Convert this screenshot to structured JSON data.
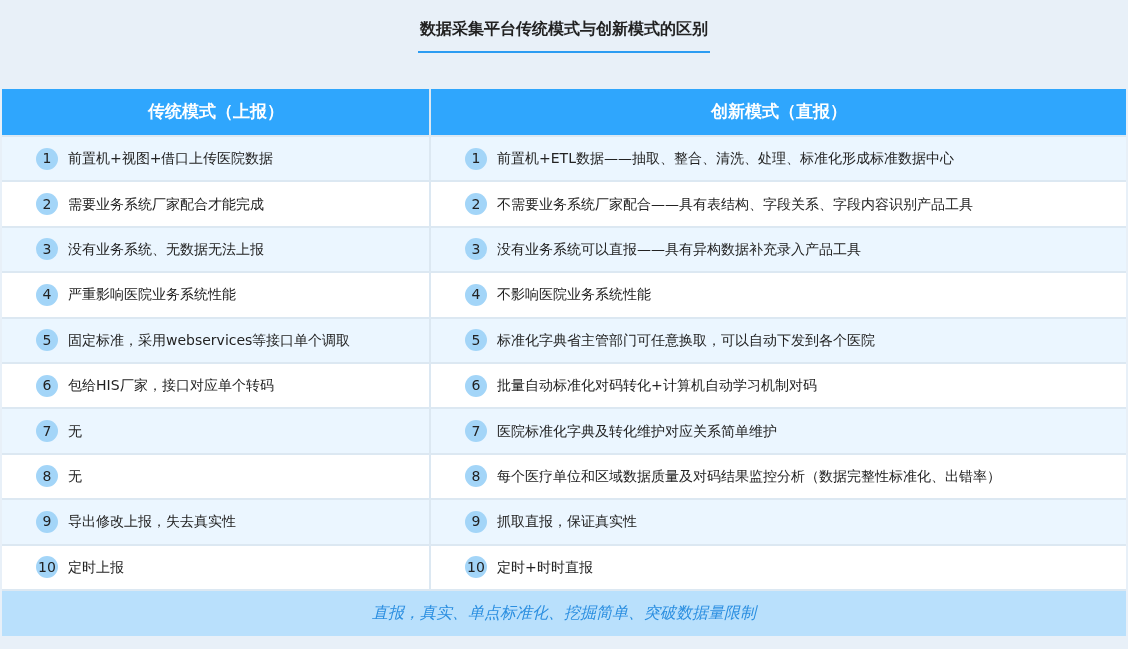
{
  "title": "数据采集平台传统模式与创新模式的区别",
  "table": {
    "columns": [
      "传统模式（上报）",
      "创新模式（直报）"
    ],
    "rows": [
      {
        "cells": [
          {
            "number": "1",
            "text": "前置机+视图+借口上传医院数据"
          },
          {
            "number": "1",
            "text": "前置机+ETL数据——抽取、整合、清洗、处理、标准化形成标准数据中心"
          }
        ]
      },
      {
        "cells": [
          {
            "number": "2",
            "text": "需要业务系统厂家配合才能完成"
          },
          {
            "number": "2",
            "text": "不需要业务系统厂家配合——具有表结构、字段关系、字段内容识别产品工具"
          }
        ]
      },
      {
        "cells": [
          {
            "number": "3",
            "text": "没有业务系统、无数据无法上报"
          },
          {
            "number": "3",
            "text": "没有业务系统可以直报——具有异构数据补充录入产品工具"
          }
        ]
      },
      {
        "cells": [
          {
            "number": "4",
            "text": "严重影响医院业务系统性能"
          },
          {
            "number": "4",
            "text": "不影响医院业务系统性能"
          }
        ]
      },
      {
        "cells": [
          {
            "number": "5",
            "text": "固定标准，采用webservices等接口单个调取"
          },
          {
            "number": "5",
            "text": "标准化字典省主管部门可任意换取，可以自动下发到各个医院"
          }
        ]
      },
      {
        "cells": [
          {
            "number": "6",
            "text": "包给HIS厂家，接口对应单个转码"
          },
          {
            "number": "6",
            "text": "批量自动标准化对码转化+计算机自动学习机制对码"
          }
        ]
      },
      {
        "cells": [
          {
            "number": "7",
            "text": "无"
          },
          {
            "number": "7",
            "text": "医院标准化字典及转化维护对应关系简单维护"
          }
        ]
      },
      {
        "cells": [
          {
            "number": "8",
            "text": "无"
          },
          {
            "number": "8",
            "text": "每个医疗单位和区域数据质量及对码结果监控分析（数据完整性标准化、出错率）"
          }
        ]
      },
      {
        "cells": [
          {
            "number": "9",
            "text": "导出修改上报，失去真实性"
          },
          {
            "number": "9",
            "text": "抓取直报，保证真实性"
          }
        ]
      },
      {
        "cells": [
          {
            "number": "10",
            "text": "定时上报"
          },
          {
            "number": "10",
            "text": "定时+时时直报"
          }
        ]
      }
    ],
    "footer": "直报，真实、单点标准化、挖掘简单、突破数据量限制"
  }
}
